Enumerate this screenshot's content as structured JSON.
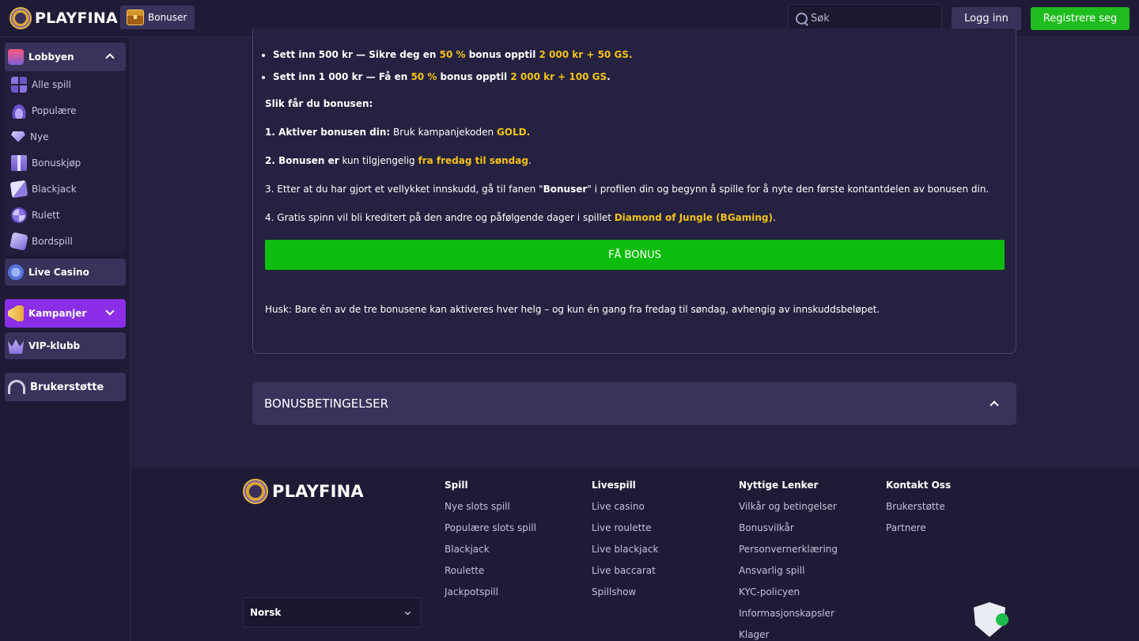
{
  "header": {
    "logo_text": "PLAYFINA",
    "bonus_label": "Bonuser",
    "search_placeholder": "Søk",
    "login_label": "Logg inn",
    "register_label": "Registrere seg"
  },
  "sidebar": {
    "lobby_label": "Lobbyen",
    "items": [
      {
        "label": "Alle spill",
        "icon": "grid-icon"
      },
      {
        "label": "Populære",
        "icon": "flame-icon"
      },
      {
        "label": "Nye",
        "icon": "diamond-icon"
      },
      {
        "label": "Bonuskjøp",
        "icon": "gift-icon"
      },
      {
        "label": "Blackjack",
        "icon": "cards-icon"
      },
      {
        "label": "Rulett",
        "icon": "roulette-icon"
      },
      {
        "label": "Bordspill",
        "icon": "dice-icon"
      }
    ],
    "live_casino_label": "Live Casino",
    "promotions_label": "Kampanjer",
    "vip_label": "VIP-klubb",
    "support_label": "Brukerstøtte"
  },
  "content": {
    "bullet1": {
      "pre": "Sett inn 500 kr — Sikre deg en ",
      "pct": "50 %",
      "mid": " bonus opptil ",
      "amount": "2 000 kr + 50 GS",
      "end": "."
    },
    "bullet2": {
      "pre": "Sett inn 1 000 kr — Få en ",
      "pct": "50 %",
      "mid": " bonus opptil ",
      "amount": "2 000 kr + 100 GS",
      "end": "."
    },
    "how_heading": "Slik får du bonusen:",
    "step1": {
      "bold": "1. Aktiver bonusen din:",
      "text": " Bruk kampanjekoden ",
      "code": "GOLD",
      "end": "."
    },
    "step2": {
      "bold": "2. Bonusen er",
      "text": " kun tilgjengelig ",
      "days": "fra fredag til søndag",
      "end": "."
    },
    "step3": {
      "pre": "3. Etter at du har gjort et vellykket innskudd, gå til fanen \"",
      "bold": "Bonuser",
      "post": "\" i profilen din og begynn å spille for å nyte den første kontantdelen av bonusen din."
    },
    "step4": {
      "pre": "4. Gratis spinn vil bli kreditert på den andre og påfølgende dager i spillet ",
      "game": "Diamond of Jungle (BGaming)",
      "end": "."
    },
    "cta_label": "FÅ BONUS",
    "note": "Husk: Bare én av de tre bonusene kan aktiveres hver helg – og kun én gang fra fredag til søndag, avhengig av innskuddsbeløpet.",
    "terms_label": "BONUSBETINGELSER"
  },
  "footer": {
    "logo_text": "PLAYFINA",
    "columns": [
      {
        "title": "Spill",
        "links": [
          "Nye slots spill",
          "Populære slots spill",
          "Blackjack",
          "Roulette",
          "Jackpotspill"
        ]
      },
      {
        "title": "Livespill",
        "links": [
          "Live casino",
          "Live roulette",
          "Live blackjack",
          "Live baccarat",
          "Spillshow"
        ]
      },
      {
        "title": "Nyttige Lenker",
        "links": [
          "Vilkår og betingelser",
          "Bonusvilkår",
          "Personvernerklæring",
          "Ansvarlig spill",
          "KYC-policyen",
          "Informasjonskapsler",
          "Klager"
        ]
      },
      {
        "title": "Kontakt Oss",
        "links": [
          "Brukerstøtte",
          "Partnere"
        ]
      }
    ],
    "language": "Norsk"
  },
  "colors": {
    "accent_green": "#0dbd0d",
    "gold": "#f2c316",
    "promo_purple": "#8a2ee8"
  }
}
